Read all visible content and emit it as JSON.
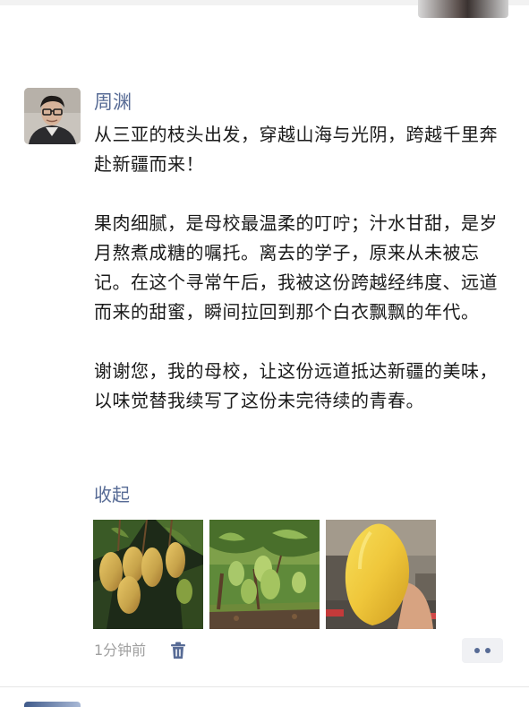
{
  "post": {
    "author": "周渊",
    "paragraphs": [
      "从三亚的枝头出发，穿越山海与光阴，跨越千里奔赴新疆而来！",
      "果肉细腻，是母校最温柔的叮咛；汁水甘甜，是岁月熬煮成糖的嘱托。离去的学子，原来从未被忘记。在这个寻常午后，我被这份跨越经纬度、远道而来的甜蜜，瞬间拉回到那个白衣飘飘的年代。",
      "谢谢您，我的母校，让这份远道抵达新疆的美味，以味觉替我续写了这份未完待续的青春。"
    ],
    "collapse_label": "收起",
    "timestamp": "1分钟前",
    "photos": [
      "mango-tree-photo",
      "mango-orchard-photo",
      "yellow-mango-in-hand-photo"
    ]
  },
  "icons": {
    "delete": "trash-icon",
    "more": "more-dots-icon"
  },
  "colors": {
    "link": "#576b95",
    "text": "#1a1a1a",
    "meta": "#a0a0a0",
    "more_button_bg": "#f0f1f4"
  }
}
